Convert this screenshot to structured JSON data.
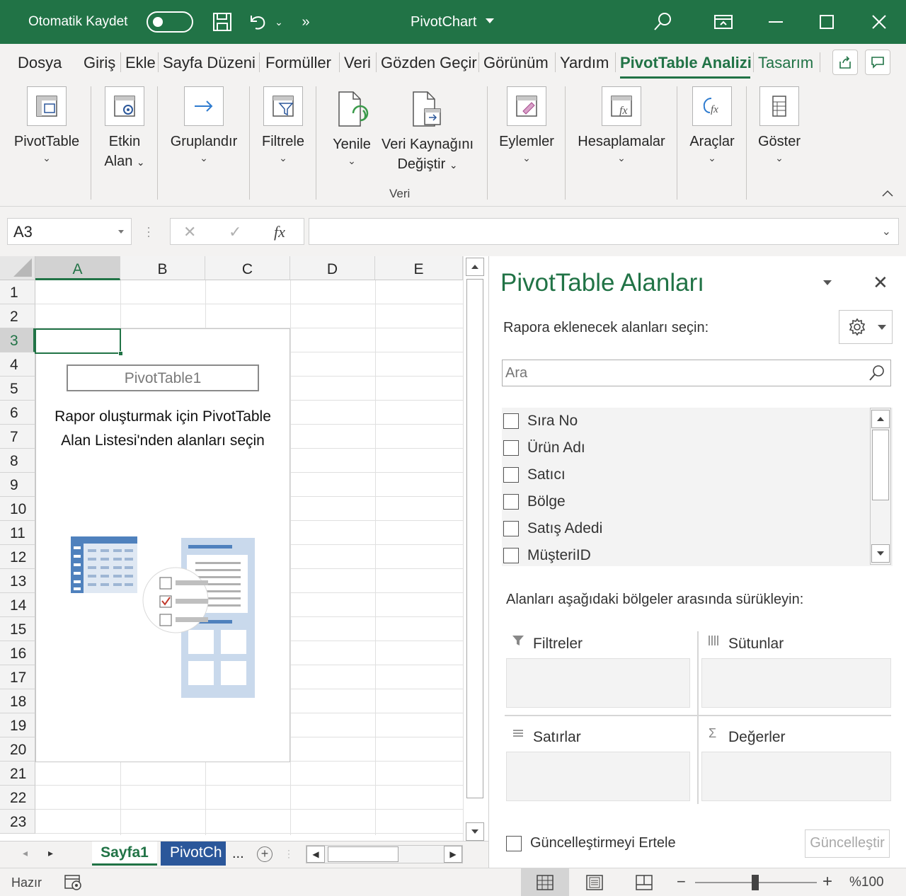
{
  "colors": {
    "excel_green": "#217346",
    "sheet_blue": "#2b579a"
  },
  "titlebar": {
    "autosave_label": "Otomatik Kaydet",
    "autosave_state": "off",
    "document_title": "PivotChart",
    "icons": [
      "save-icon",
      "undo-icon",
      "more-commands-icon",
      "search-icon",
      "ribbon-display-icon",
      "minimize-icon",
      "maximize-icon",
      "close-icon"
    ]
  },
  "ribbon_tabs": [
    "Dosya",
    "Giriş",
    "Ekle",
    "Sayfa Düzeni",
    "Formüller",
    "Veri",
    "Gözden Geçir",
    "Görünüm",
    "Yardım",
    "PivotTable Analizi",
    "Tasarım"
  ],
  "active_tab": "PivotTable Analizi",
  "ribbon": {
    "pivottable": "PivotTable",
    "active_field_1": "Etkin",
    "active_field_2": "Alan",
    "group": "Gruplandır",
    "filter": "Filtrele",
    "refresh": "Yenile",
    "change_source_1": "Veri Kaynağını",
    "change_source_2": "Değiştir",
    "actions": "Eylemler",
    "calculations": "Hesaplamalar",
    "tools": "Araçlar",
    "show": "Göster",
    "data_group_label": "Veri"
  },
  "formula_bar": {
    "name_box": "A3",
    "formula": ""
  },
  "grid": {
    "columns": [
      "A",
      "B",
      "C",
      "D",
      "E"
    ],
    "rows": [
      "1",
      "2",
      "3",
      "4",
      "5",
      "6",
      "7",
      "8",
      "9",
      "10",
      "11",
      "12",
      "13",
      "14",
      "15",
      "16",
      "17",
      "18",
      "19",
      "20",
      "21",
      "22",
      "23"
    ],
    "selected_cell": "A3"
  },
  "pivot_placeholder": {
    "name": "PivotTable1",
    "message_line1": "Rapor oluşturmak için PivotTable",
    "message_line2": "Alan Listesi'nden alanları seçin"
  },
  "sheets": {
    "active": "Sayfa1",
    "other": "PivotCh",
    "more": "..."
  },
  "pane": {
    "title": "PivotTable Alanları",
    "subtitle": "Rapora eklenecek alanları seçin:",
    "search_placeholder": "Ara",
    "fields": [
      "Sıra No",
      "Ürün Adı",
      "Satıcı",
      "Bölge",
      "Satış Adedi",
      "MüşteriID"
    ],
    "drag_hint": "Alanları aşağıdaki bölgeler arasında sürükleyin:",
    "areas": {
      "filters": "Filtreler",
      "columns": "Sütunlar",
      "rows": "Satırlar",
      "values": "Değerler"
    },
    "defer_label": "Güncelleştirmeyi Ertele",
    "update_button": "Güncelleştir"
  },
  "statusbar": {
    "status": "Hazır",
    "zoom": "%100"
  }
}
